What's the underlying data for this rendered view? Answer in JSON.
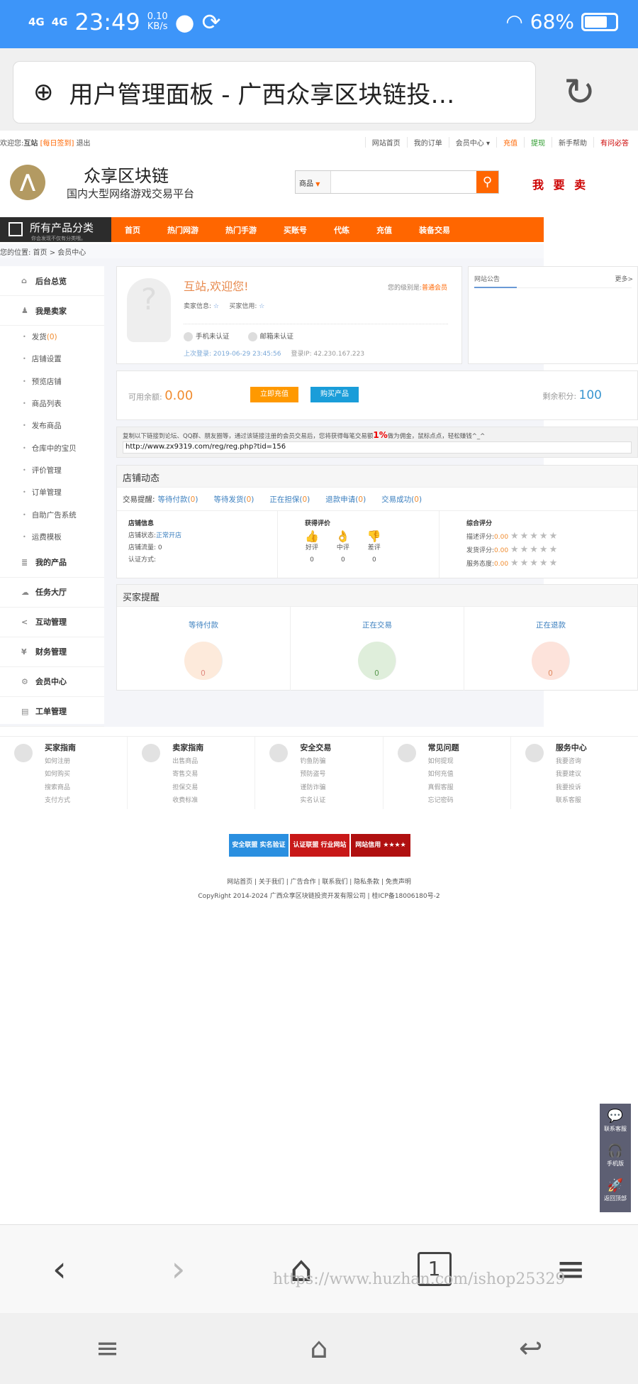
{
  "status": {
    "signal1": "4G",
    "signal2": "4G",
    "time": "23:49",
    "speed": "0.10",
    "speed_unit": "KB/s",
    "battery": "68%",
    "battery_level": 0.68
  },
  "browser": {
    "title": "用户管理面板 - 广西众享区块链投…",
    "tabs_count": "1",
    "watermark": "https://www.huzhan.com/ishop25329"
  },
  "topbar": {
    "welcome": "欢迎您:",
    "user": "互站",
    "signin": "[每日签到]",
    "logout": "退出",
    "links": [
      "网站首页",
      "我的订单",
      "会员中心 ▾",
      "充值",
      "提现",
      "新手帮助",
      "有问必答"
    ]
  },
  "header": {
    "logo_text": "众享区块链",
    "slogan": "国内大型网络游戏交易平台",
    "search_category": "商品",
    "search_placeholder": "",
    "sell": "我 要 卖"
  },
  "nav": {
    "all_title": "所有产品分类",
    "all_sub": "你会发现不仅有分类哦。",
    "items": [
      "首页",
      "热门网游",
      "热门手游",
      "买账号",
      "代练",
      "充值",
      "装备交易"
    ]
  },
  "breadcrumb": "您的位置: 首页 > 会员中心",
  "sidebar": {
    "overview": "后台总览",
    "seller": "我是卖家",
    "ship": "发货",
    "ship_count": "(0)",
    "sub": [
      "店铺设置",
      "预览店铺",
      "商品列表",
      "发布商品",
      "仓库中的宝贝",
      "评价管理",
      "订单管理",
      "自助广告系统",
      "运费模板"
    ],
    "groups": [
      "我的产品",
      "任务大厅",
      "互动管理",
      "财务管理",
      "会员中心",
      "工单管理"
    ]
  },
  "profile": {
    "welcome": "互站,欢迎您!",
    "level_label": "您的级别是:",
    "level": "普通会员",
    "seller_credit": "卖家信息:",
    "buyer_credit": "买家信用:",
    "phone": "手机未认证",
    "email": "邮箱未认证",
    "last_login_label": "上次登录:",
    "last_login": "2019-06-29 23:45:56",
    "ip_label": "登录IP:",
    "ip": "42.230.167.223"
  },
  "notice": {
    "title": "网站公告",
    "more": "更多>"
  },
  "balance": {
    "label": "可用余额:",
    "value": "0.00",
    "recharge": "立即充值",
    "buy": "购买产品",
    "points_label": "剩余积分:",
    "points": "100"
  },
  "referral": {
    "text1": "复制以下链接到论坛、QQ群、朋友圈等，通过该链接注册的会员交易后，您将获得每笔交易额",
    "pct": "1%",
    "text2": "做为佣金，鼠标点点，轻松赚钱^_^",
    "url": "http://www.zx9319.com/reg/reg.php?tid=156"
  },
  "shop": {
    "title": "店铺动态",
    "reminder_label": "交易提醒:",
    "reminders": [
      {
        "label": "等待付款",
        "count": "0"
      },
      {
        "label": "等待发货",
        "count": "0"
      },
      {
        "label": "正在担保",
        "count": "0"
      },
      {
        "label": "退款申请",
        "count": "0"
      },
      {
        "label": "交易成功",
        "count": "0"
      }
    ],
    "info_title": "店铺信息",
    "state_label": "店铺状态:",
    "state": "正常开店",
    "traffic": "店铺流量: 0",
    "auth": "认证方式:",
    "eval_title": "获得评价",
    "evals": [
      {
        "label": "好评",
        "count": "0"
      },
      {
        "label": "中评",
        "count": "0"
      },
      {
        "label": "差评",
        "count": "0"
      }
    ],
    "score_title": "综合评分",
    "scores": [
      {
        "label": "描述评分:",
        "value": "0.00"
      },
      {
        "label": "发货评分:",
        "value": "0.00"
      },
      {
        "label": "服务态度:",
        "value": "0.00"
      }
    ]
  },
  "buyer": {
    "title": "买家提醒",
    "items": [
      {
        "label": "等待付款",
        "count": "0",
        "bg": "#fdeadb",
        "fg": "#e08a80"
      },
      {
        "label": "正在交易",
        "count": "0",
        "bg": "#dfeedb",
        "fg": "#5a9a50"
      },
      {
        "label": "正在退款",
        "count": "0",
        "bg": "#fde3db",
        "fg": "#e08a60"
      }
    ]
  },
  "help": [
    {
      "title": "买家指南",
      "links": [
        "如何注册",
        "如何购买",
        "搜索商品",
        "支付方式"
      ]
    },
    {
      "title": "卖家指南",
      "links": [
        "出售商品",
        "寄售交易",
        "担保交易",
        "收费标准"
      ]
    },
    {
      "title": "安全交易",
      "links": [
        "钓鱼防骗",
        "预防盗号",
        "谨防诈骗",
        "实名认证"
      ]
    },
    {
      "title": "常见问题",
      "links": [
        "如何提现",
        "如何充值",
        "真假客服",
        "忘记密码"
      ]
    },
    {
      "title": "服务中心",
      "links": [
        "我要咨询",
        "我要建议",
        "我要投诉",
        "联系客服"
      ]
    }
  ],
  "badges": [
    "安全联盟 实名验证",
    "认证联盟 行业网站",
    "网站信用 ★★★★"
  ],
  "footer": {
    "links": "网站首页 | 关于我们 | 广告合作 | 联系我们 | 隐私条款 | 免责声明",
    "copyright": "CopyRight 2014-2024 广西众享区块链投资开发有限公司 | 桂ICP备18006180号-2"
  },
  "float": [
    "联系客服",
    "手机版",
    "返回顶部"
  ]
}
